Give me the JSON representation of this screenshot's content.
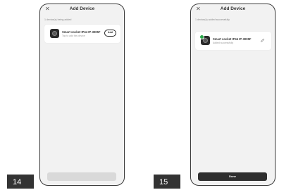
{
  "screens": [
    {
      "close_glyph": "✕",
      "title": "Add Device",
      "status": "1 device(s) being added",
      "device": {
        "name": "Smart socket IP44 IP-3005F",
        "sub": "Tap to add this device",
        "icon": "socket-device-icon"
      },
      "action_label": "Add",
      "bottom_label": "",
      "step": "14"
    },
    {
      "close_glyph": "✕",
      "title": "Add Device",
      "status": "1 device(s) added successfully",
      "device": {
        "name": "Smart socket IP44 IP-3005F",
        "sub": "Added successfully",
        "icon": "socket-device-icon"
      },
      "edit_icon": "pencil-icon",
      "bottom_label": "Done",
      "step": "15"
    }
  ],
  "colors": {
    "screen_bg": "#f2f2f2",
    "success": "#2aa84a",
    "done_button": "#2e2e2e",
    "disabled_button": "#d9d9d9",
    "step_label_bg": "#333333"
  }
}
